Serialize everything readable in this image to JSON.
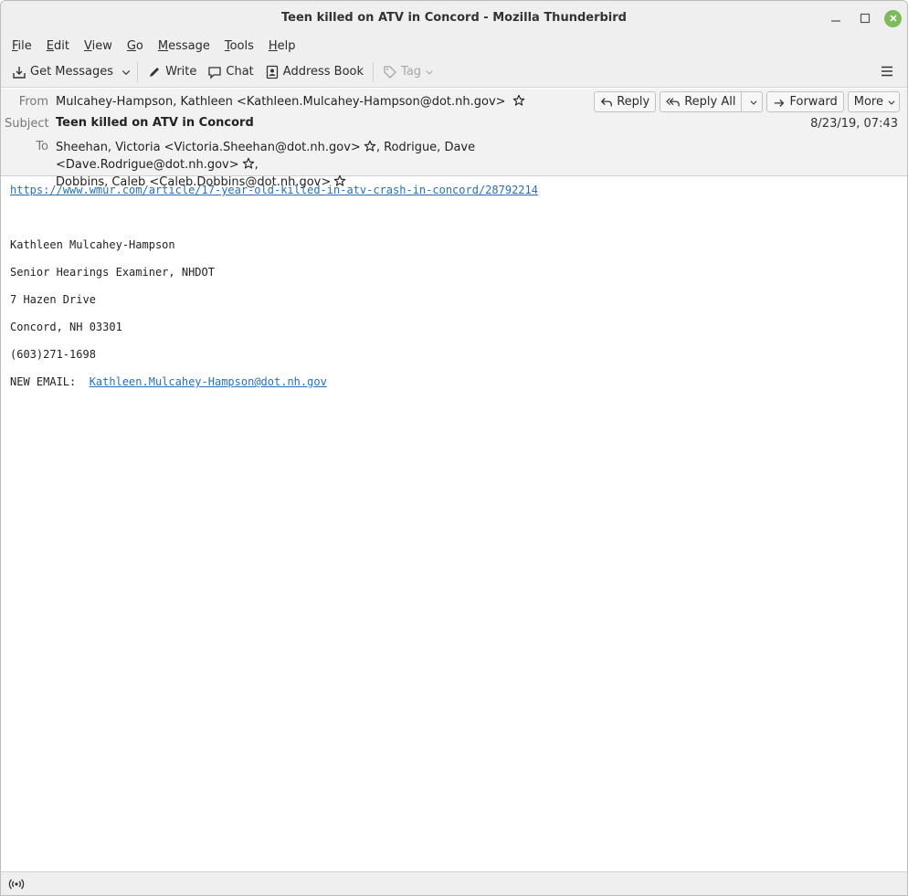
{
  "window": {
    "title": "Teen killed on ATV in Concord - Mozilla Thunderbird"
  },
  "menu": [
    {
      "label": "File",
      "mnemonic": "F",
      "rest": "ile"
    },
    {
      "label": "Edit",
      "mnemonic": "E",
      "rest": "dit"
    },
    {
      "label": "View",
      "mnemonic": "V",
      "rest": "iew"
    },
    {
      "label": "Go",
      "mnemonic": "G",
      "rest": "o"
    },
    {
      "label": "Message",
      "mnemonic": "M",
      "rest": "essage"
    },
    {
      "label": "Tools",
      "mnemonic": "T",
      "rest": "ools"
    },
    {
      "label": "Help",
      "mnemonic": "H",
      "rest": "elp"
    }
  ],
  "toolbar": {
    "get_messages": "Get Messages",
    "write": "Write",
    "chat": "Chat",
    "address_book": "Address Book",
    "tag": "Tag"
  },
  "header": {
    "from_label": "From",
    "from_value": "Mulcahey-Hampson, Kathleen <Kathleen.Mulcahey-Hampson@dot.nh.gov>",
    "subject_label": "Subject",
    "subject_value": "Teen killed on ATV in Concord",
    "to_label": "To",
    "to_recipient_1": "Sheehan, Victoria <Victoria.Sheehan@dot.nh.gov>",
    "to_recipient_2": "Rodrigue, Dave <Dave.Rodrigue@dot.nh.gov>",
    "to_recipient_3": "Dobbins, Caleb <Caleb.Dobbins@dot.nh.gov>",
    "date": "8/23/19, 07:43",
    "buttons": {
      "reply": "Reply",
      "reply_all": "Reply All",
      "forward": "Forward",
      "more": "More"
    }
  },
  "body": {
    "link": "https://www.wmur.com/article/17-year-old-killed-in-atv-crash-in-concord/28792214",
    "sig_name": "Kathleen Mulcahey-Hampson",
    "sig_title": "Senior Hearings Examiner, NHDOT",
    "sig_address": "7 Hazen Drive",
    "sig_city": "Concord, NH 03301",
    "sig_phone": "(603)271-1698",
    "sig_email_label": "NEW EMAIL:",
    "sig_email": "Kathleen.Mulcahey-Hampson@dot.nh.gov"
  },
  "icons": {
    "get_messages": "inbox-download-icon",
    "write": "pencil-icon",
    "chat": "chat-bubble-icon",
    "address_book": "address-book-icon",
    "tag": "tag-icon",
    "menu": "hamburger-menu-icon",
    "status": "wifi-antenna-icon",
    "star": "star-icon"
  },
  "colors": {
    "link": "#2a6fb5",
    "close_button": "#7cba5b"
  }
}
